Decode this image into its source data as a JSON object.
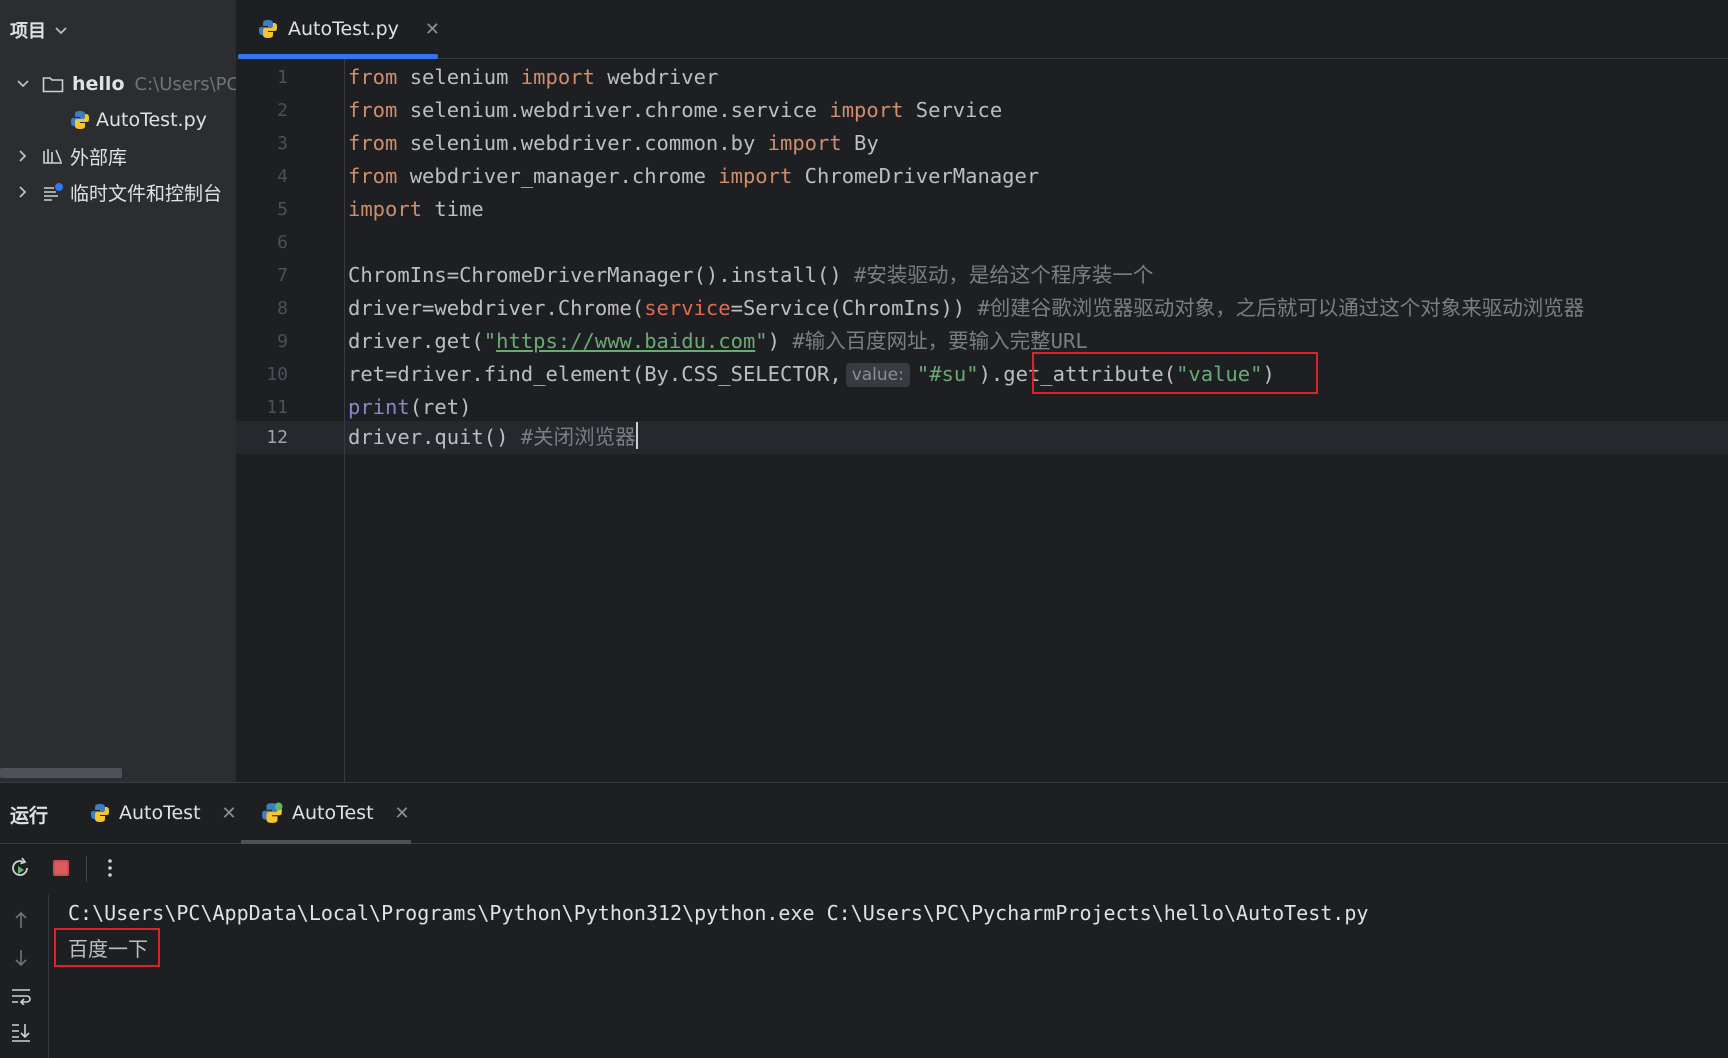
{
  "project_panel": {
    "header": "项目",
    "tree": {
      "project_name": "hello",
      "project_path": "C:\\Users\\PC\\F",
      "file": "AutoTest.py",
      "external_libs": "外部库",
      "scratches": "临时文件和控制台"
    }
  },
  "editor": {
    "tab_label": "AutoTest.py",
    "line_numbers": [
      "1",
      "2",
      "3",
      "4",
      "5",
      "6",
      "7",
      "8",
      "9",
      "10",
      "11",
      "12"
    ],
    "code": {
      "l1": {
        "kw1": "from",
        "t1": " selenium ",
        "kw2": "import",
        "t2": " webdriver"
      },
      "l2": {
        "kw1": "from",
        "t1": " selenium.webdriver.chrome.service ",
        "kw2": "import",
        "t2": " Service"
      },
      "l3": {
        "kw1": "from",
        "t1": " selenium.webdriver.common.by ",
        "kw2": "import",
        "t2": " By"
      },
      "l4": {
        "kw1": "from",
        "t1": " webdriver_manager.chrome ",
        "kw2": "import",
        "t2": " ChromeDriverManager"
      },
      "l5": {
        "kw1": "import",
        "t1": " time"
      },
      "l7": {
        "t1": "ChromIns=ChromeDriverManager().install() ",
        "cmt": "#安装驱动，是给这个程序装一个"
      },
      "l8": {
        "t1": "driver=webdriver.Chrome(",
        "param": "service",
        "t2": "=Service(ChromIns)) ",
        "cmt": "#创建谷歌浏览器驱动对象，之后就可以通过这个对象来驱动浏览器"
      },
      "l9": {
        "t1": "driver.get(",
        "q1": "\"",
        "url": "https://www.baidu.com",
        "q2": "\"",
        "t2": ") ",
        "cmt": "#输入百度网址，要输入完整URL"
      },
      "l10": {
        "t1": "ret=driver.find_element(By.CSS_SELECTOR,",
        "hint": "value:",
        "str1": "\"#su\"",
        "t2": ").get_attribute(",
        "str2": "\"value\"",
        "t3": ")"
      },
      "l11": {
        "builtin": "print",
        "t1": "(ret)"
      },
      "l12": {
        "t1": "driver.quit() ",
        "cmt": "#关闭浏览器"
      }
    }
  },
  "run_panel": {
    "title": "运行",
    "tabs": [
      {
        "label": "AutoTest"
      },
      {
        "label": "AutoTest"
      }
    ],
    "output": {
      "command": "C:\\Users\\PC\\AppData\\Local\\Programs\\Python\\Python312\\python.exe C:\\Users\\PC\\PycharmProjects\\hello\\AutoTest.py",
      "result": "百度一下"
    }
  },
  "colors": {
    "accent": "#3574f0",
    "highlight_box": "#e0202a",
    "keyword": "#cf8e6d",
    "string": "#6aab73",
    "comment": "#7a7e85"
  },
  "icons": [
    "chevron-down-icon",
    "folder-icon",
    "python-file-icon",
    "library-icon",
    "scratches-icon",
    "rerun-icon",
    "stop-icon",
    "more-icon",
    "scroll-up-icon",
    "scroll-down-icon",
    "soft-wrap-icon",
    "scroll-to-end-icon"
  ]
}
